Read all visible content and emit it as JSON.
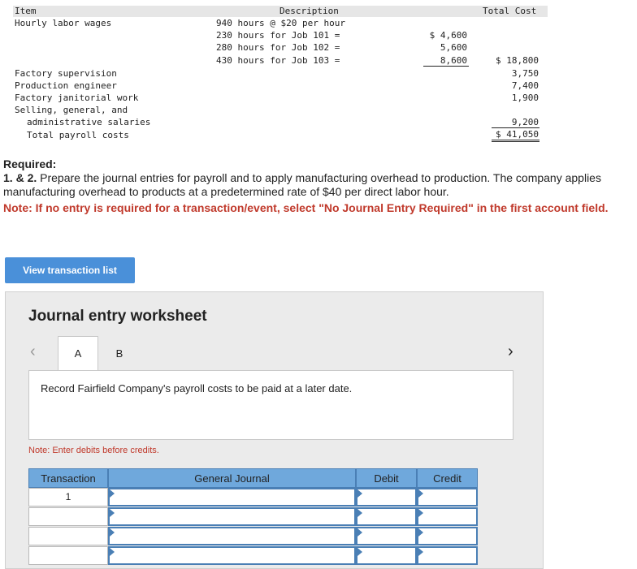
{
  "payroll_table": {
    "headers": {
      "item": "Item",
      "description": "Description",
      "total_cost": "Total Cost"
    },
    "rows": {
      "hourly_wages": {
        "item": "Hourly labor wages",
        "desc_line1": "940 hours @ $20 per hour",
        "job101": "230 hours for Job 101 =",
        "job102": "280 hours for Job 102 =",
        "job103": "430 hours for Job 103 =",
        "amt101": "$ 4,600",
        "amt102": "5,600",
        "amt103": "8,600",
        "total": "$ 18,800"
      },
      "factory_supervision": {
        "item": "Factory supervision",
        "total": "3,750"
      },
      "production_engineer": {
        "item": "Production engineer",
        "total": "7,400"
      },
      "janitorial": {
        "item": "Factory janitorial work",
        "total": "1,900"
      },
      "selling": {
        "item_line1": "Selling, general, and",
        "item_line2": "administrative salaries",
        "total": "9,200"
      },
      "total_payroll": {
        "item": "Total payroll costs",
        "total": "$ 41,050"
      }
    }
  },
  "required": {
    "title": "Required:",
    "prefix": "1. & 2.",
    "text": " Prepare the journal entries for payroll and to apply manufacturing overhead to production. The company applies manufacturing overhead to products at a predetermined rate of $40 per direct labor hour.",
    "note": "Note: If no entry is required for a transaction/event, select \"No Journal Entry Required\" in the first account field."
  },
  "view_transaction_button": "View transaction list",
  "worksheet": {
    "title": "Journal entry worksheet",
    "tabs": [
      "A",
      "B"
    ],
    "description": "Record Fairfield Company's payroll costs to be paid at a later date.",
    "note": "Note: Enter debits before credits.",
    "columns": {
      "transaction": "Transaction",
      "journal": "General Journal",
      "debit": "Debit",
      "credit": "Credit"
    },
    "transaction_number": "1"
  }
}
